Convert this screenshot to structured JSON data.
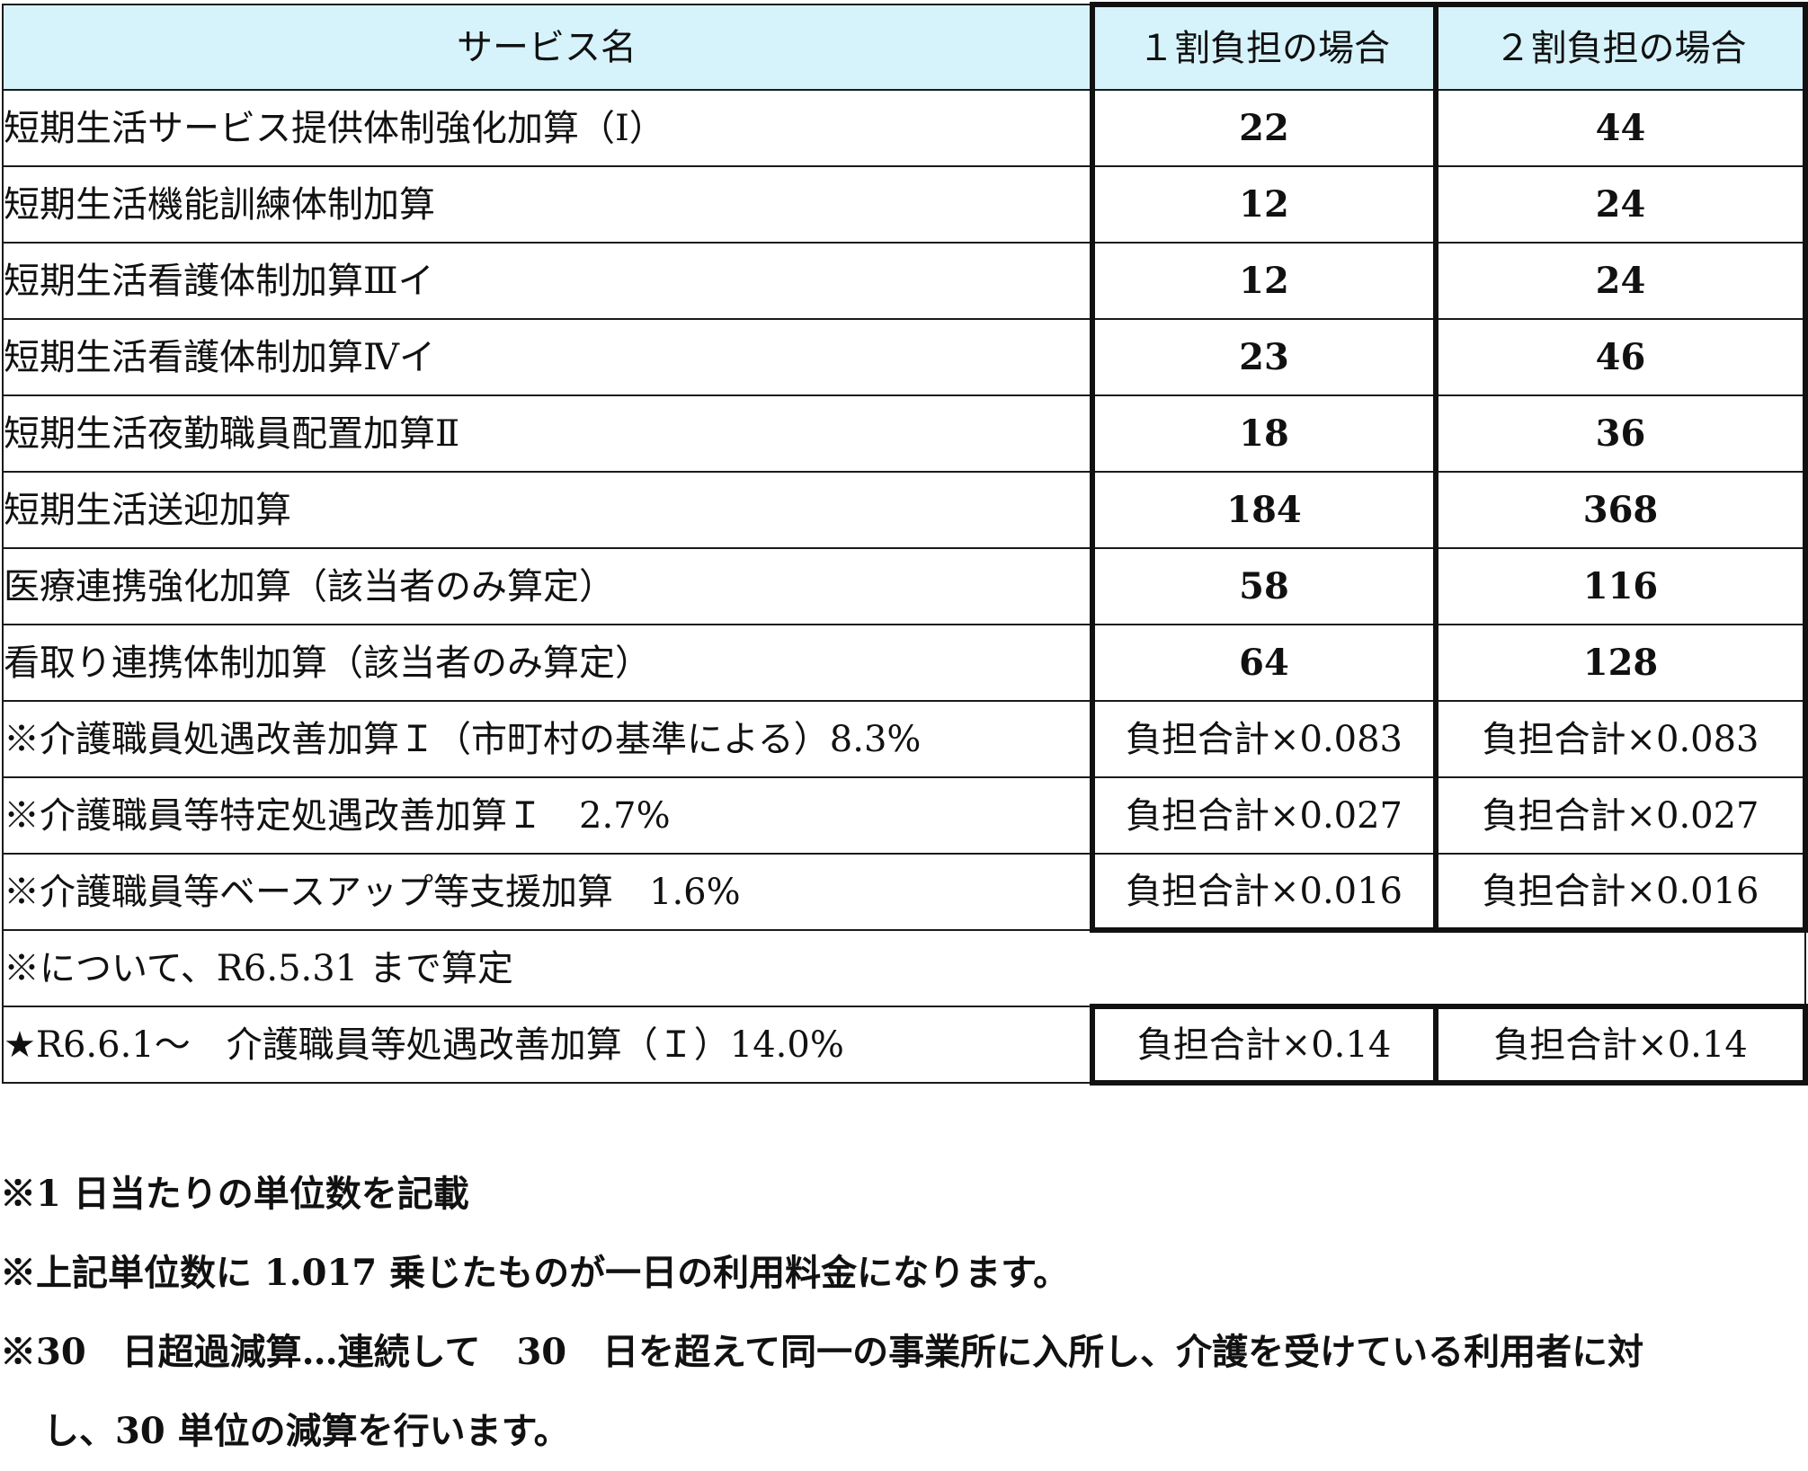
{
  "table": {
    "headers": {
      "service": "サービス名",
      "one": "１割負担の場合",
      "two": "２割負担の場合"
    },
    "rows": [
      {
        "name": "短期生活サービス提供体制強化加算（Ⅰ）",
        "one": "22",
        "two": "44"
      },
      {
        "name": "短期生活機能訓練体制加算",
        "one": "12",
        "two": "24"
      },
      {
        "name": "短期生活看護体制加算Ⅲイ",
        "one": "12",
        "two": "24"
      },
      {
        "name": "短期生活看護体制加算Ⅳイ",
        "one": "23",
        "two": "46"
      },
      {
        "name": "短期生活夜勤職員配置加算Ⅱ",
        "one": "18",
        "two": "36"
      },
      {
        "name": "短期生活送迎加算",
        "one": "184",
        "two": "368"
      },
      {
        "name": "医療連携強化加算（該当者のみ算定）",
        "one": "58",
        "two": "116"
      },
      {
        "name": "看取り連携体制加算（該当者のみ算定）",
        "one": "64",
        "two": "128"
      }
    ],
    "formula_rows": [
      {
        "name": "※介護職員処遇改善加算Ｉ（市町村の基準による）8.3%",
        "one": "負担合計×0.083",
        "two": "負担合計×0.083"
      },
      {
        "name": "※介護職員等特定処遇改善加算Ｉ　2.7%",
        "one": "負担合計×0.027",
        "two": "負担合計×0.027"
      },
      {
        "name": "※介護職員等ベースアップ等支援加算　1.6%",
        "one": "負担合計×0.016",
        "two": "負担合計×0.016"
      }
    ],
    "span_note": "※について、R6.5.31 まで算定",
    "final_row": {
      "name": "★R6.6.1～　介護職員等処遇改善加算（Ｉ）14.0%",
      "one": "負担合計×0.14",
      "two": "負担合計×0.14"
    }
  },
  "notes": {
    "line1": "※1 日当たりの単位数を記載",
    "line2": "※上記単位数に 1.017 乗じたものが一日の利用料金になります。",
    "line3": "※30　日超過減算…連続して　30　日を超えて同一の事業所に入所し、介護を受けている利用者に対",
    "line4": "し、30 単位の減算を行います。"
  }
}
